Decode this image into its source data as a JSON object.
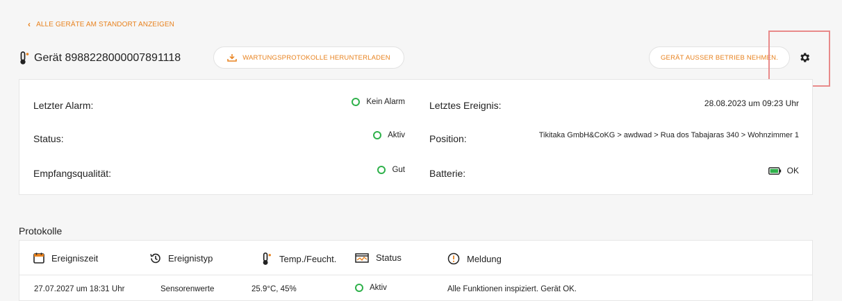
{
  "nav": {
    "back_label": "ALLE GERÄTE AM STANDORT ANZEIGEN"
  },
  "device": {
    "title": "Gerät 8988228000007891118",
    "download_label": "WARTUNGSPROTOKOLLE HERUNTERLADEN",
    "decommission_label": "GERÄT AUSSER BETRIEB NEHMEN."
  },
  "info": {
    "last_alarm_label": "Letzter Alarm:",
    "last_alarm_value": "Kein Alarm",
    "status_label": "Status:",
    "status_value": "Aktiv",
    "reception_label": "Empfangsqualität:",
    "reception_value": "Gut",
    "last_event_label": "Letztes Ereignis:",
    "last_event_value": "28.08.2023 um 09:23 Uhr",
    "position_label": "Position:",
    "position_value": "Tikitaka GmbH&CoKG > awdwad > Rua dos Tabajaras 340 > Wohnzimmer 1",
    "battery_label": "Batterie:",
    "battery_value": "OK"
  },
  "logs": {
    "title": "Protokolle",
    "columns": [
      "Ereigniszeit",
      "Ereignistyp",
      "Temp./Feucht.",
      "Status",
      "Meldung"
    ],
    "rows": [
      {
        "time": "27.07.2027 um 18:31 Uhr",
        "type": "Sensorenwerte",
        "temp": "25.9°C, 45%",
        "status": "Aktiv",
        "message": "Alle Funktionen inspiziert. Gerät OK."
      }
    ]
  },
  "colors": {
    "accent": "#e8821e",
    "ok_green": "#2fb14b",
    "highlight": "#e88a8a"
  },
  "icons": {
    "back": "chevron-left-icon",
    "device": "thermometer-icon",
    "download": "download-icon",
    "settings": "gear-icon",
    "status_ok": "status-ring-icon",
    "battery": "battery-icon",
    "time": "calendar-icon",
    "type": "history-icon",
    "temp": "thermometer-icon",
    "status": "status-chart-icon",
    "message": "alert-circle-icon"
  }
}
